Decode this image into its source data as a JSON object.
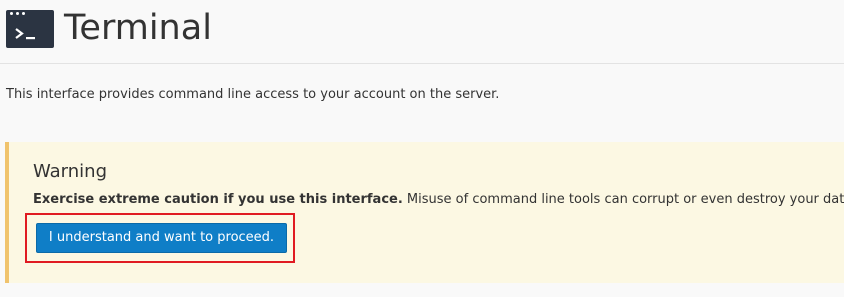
{
  "header": {
    "title": "Terminal",
    "icon": "terminal-icon"
  },
  "description": "This interface provides command line access to your account on the server.",
  "warning": {
    "heading": "Warning",
    "bold_text": "Exercise extreme caution if you use this interface.",
    "text": " Misuse of command line tools can corrupt or even destroy your data.",
    "button_label": "I understand and want to proceed."
  },
  "colors": {
    "accent_button": "#0f7ec7",
    "warning_background": "#fcf8e3",
    "warning_border": "#f0c36d",
    "highlight_outline": "#e01b22",
    "icon_background": "#2b3442"
  }
}
